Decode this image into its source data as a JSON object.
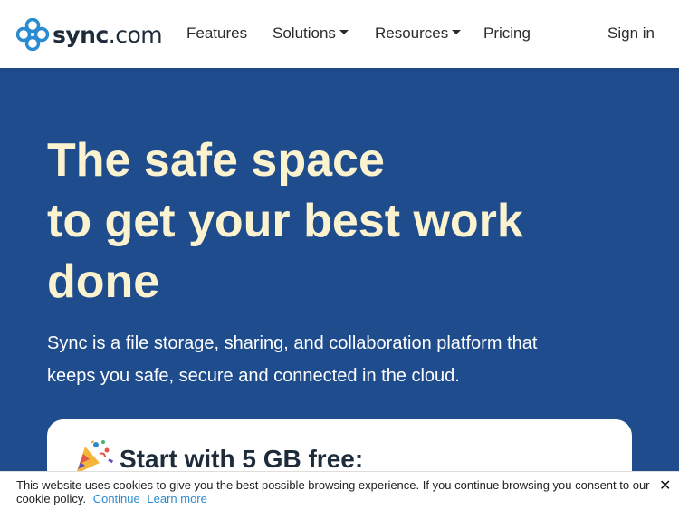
{
  "brand": {
    "logo_name": "sync",
    "logo_suffix": ".com",
    "logo_icon": "sync-logo-icon",
    "logo_color": "#2a8bd1"
  },
  "nav": {
    "features": "Features",
    "solutions": "Solutions",
    "resources": "Resources",
    "pricing": "Pricing",
    "signin": "Sign in"
  },
  "hero": {
    "headline_lines": [
      "The safe space",
      "to get your best work",
      "done"
    ],
    "subtext_lines": [
      "Sync is a file storage, sharing, and collaboration platform that",
      "keeps you safe, secure and connected in the cloud."
    ],
    "background": "#1f4c8c",
    "headline_color": "#fbf2cf"
  },
  "card": {
    "icon": "party-popper-icon",
    "title": "Start with 5 GB free:"
  },
  "cookie": {
    "text": "This website uses cookies to give you the best possible browsing experience. If you continue browsing you consent to our cookie policy.",
    "continue": "Continue",
    "learn_more": "Learn more",
    "close": "✕"
  }
}
